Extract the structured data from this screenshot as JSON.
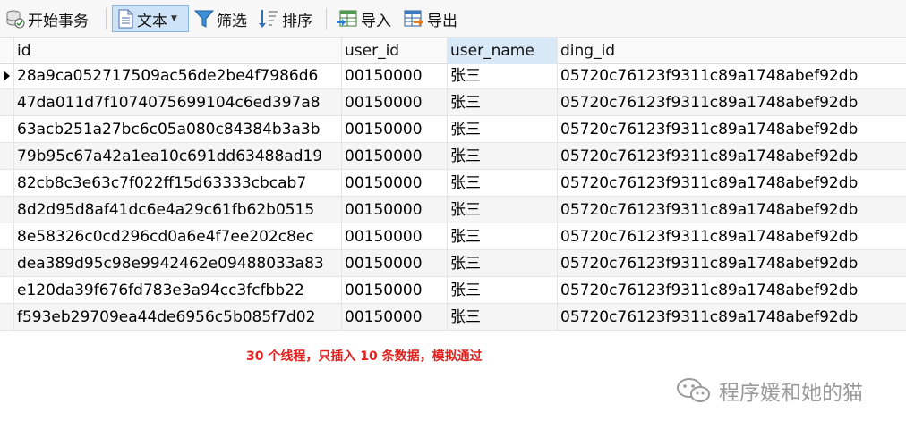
{
  "toolbar": {
    "begin_transaction": "开始事务",
    "text": "文本",
    "filter": "筛选",
    "sort": "排序",
    "import": "导入",
    "export": "导出"
  },
  "table": {
    "columns": [
      "id",
      "user_id",
      "user_name",
      "ding_id"
    ],
    "rows": [
      [
        "28a9ca052717509ac56de2be4f7986d6",
        "00150000",
        "张三",
        "05720c76123f9311c89a1748abef92db"
      ],
      [
        "47da011d7f1074075699104c6ed397a8",
        "00150000",
        "张三",
        "05720c76123f9311c89a1748abef92db"
      ],
      [
        "63acb251a27bc6c05a080c84384b3a3b",
        "00150000",
        "张三",
        "05720c76123f9311c89a1748abef92db"
      ],
      [
        "79b95c67a42a1ea10c691dd63488ad19",
        "00150000",
        "张三",
        "05720c76123f9311c89a1748abef92db"
      ],
      [
        "82cb8c3e63c7f022ff15d63333cbcab7",
        "00150000",
        "张三",
        "05720c76123f9311c89a1748abef92db"
      ],
      [
        "8d2d95d8af41dc6e4a29c61fb62b0515",
        "00150000",
        "张三",
        "05720c76123f9311c89a1748abef92db"
      ],
      [
        "8e58326c0cd296cd0a6e4f7ee202c8ec",
        "00150000",
        "张三",
        "05720c76123f9311c89a1748abef92db"
      ],
      [
        "dea389d95c98e9942462e09488033a83",
        "00150000",
        "张三",
        "05720c76123f9311c89a1748abef92db"
      ],
      [
        "e120da39f676fd783e3a94cc3fcfbb22",
        "00150000",
        "张三",
        "05720c76123f9311c89a1748abef92db"
      ],
      [
        "f593eb29709ea44de6956c5b085f7d02",
        "00150000",
        "张三",
        "05720c76123f9311c89a1748abef92db"
      ]
    ]
  },
  "annotation": "30 个线程，只插入 10 条数据，模拟通过",
  "watermark": "程序媛和她的猫",
  "colors": {
    "annotation": "#e0211d",
    "active_button": "#cfe3f8",
    "sorted_header": "#d9e8f7"
  },
  "icons": [
    "database-transaction-icon",
    "text-view-icon",
    "filter-funnel-icon",
    "sort-icon",
    "import-table-icon",
    "export-table-icon",
    "wechat-icon"
  ]
}
